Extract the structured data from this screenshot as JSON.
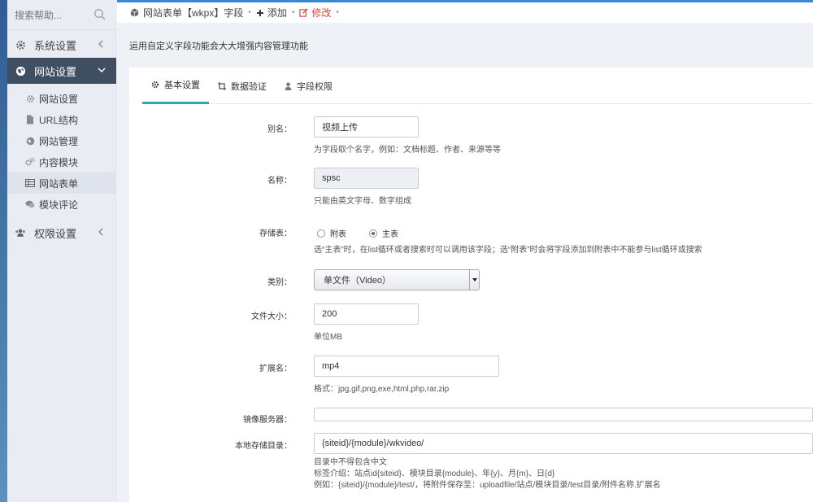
{
  "search": {
    "placeholder": "搜索帮助..."
  },
  "sidebar": {
    "system": "系统设置",
    "website": "网站设置",
    "sub": [
      "网站设置",
      "URL结构",
      "网站管理",
      "内容模块",
      "网站表单",
      "模块评论"
    ],
    "permission": "权限设置"
  },
  "topbar": {
    "crumb": "网站表单【wkpx】字段",
    "add": "添加",
    "edit": "修改"
  },
  "description": "运用自定义字段功能会大大增强内容管理功能",
  "tabs": [
    "基本设置",
    "数据验证",
    "字段权限"
  ],
  "form": {
    "alias": {
      "label": "别名：",
      "value": "视频上传",
      "help": "为字段取个名字，例如：文档标题、作者、来源等等"
    },
    "name": {
      "label": "名称：",
      "value": "spsc",
      "help": "只能由英文字母、数字组成"
    },
    "storage": {
      "label": "存储表：",
      "option1": "附表",
      "option2": "主表",
      "selected": "主表",
      "help": "选“主表”时，在list循环或者搜索时可以调用该字段；选“附表”时会将字段添加到附表中不能参与list循环或搜索"
    },
    "type": {
      "label": "类别：",
      "value": "单文件（Video）"
    },
    "filesize": {
      "label": "文件大小：",
      "value": "200",
      "help": "单位MB"
    },
    "ext": {
      "label": "扩展名：",
      "value": "mp4",
      "help": "格式：jpg,gif,png,exe,html,php,rar,zip"
    },
    "mirror": {
      "label": "镜像服务器：",
      "value": ""
    },
    "localdir": {
      "label": "本地存储目录：",
      "value": "{siteid}/{module}/wkvideo/",
      "help1": "目录中不得包含中文",
      "help2": "标签介绍：站点id{siteid}、模块目录{module}、年{y}、月{m}、日{d}",
      "help3": "例如：{siteid}/{module}/test/，将附件保存至：uploadfile/站点/模块目录/test目录/附件名称.扩展名"
    }
  },
  "colors": {
    "accent": "#3a87d9",
    "tab_active": "#36a2b8",
    "sidebar_active": "#3f4e60",
    "edit": "#e0463a"
  }
}
